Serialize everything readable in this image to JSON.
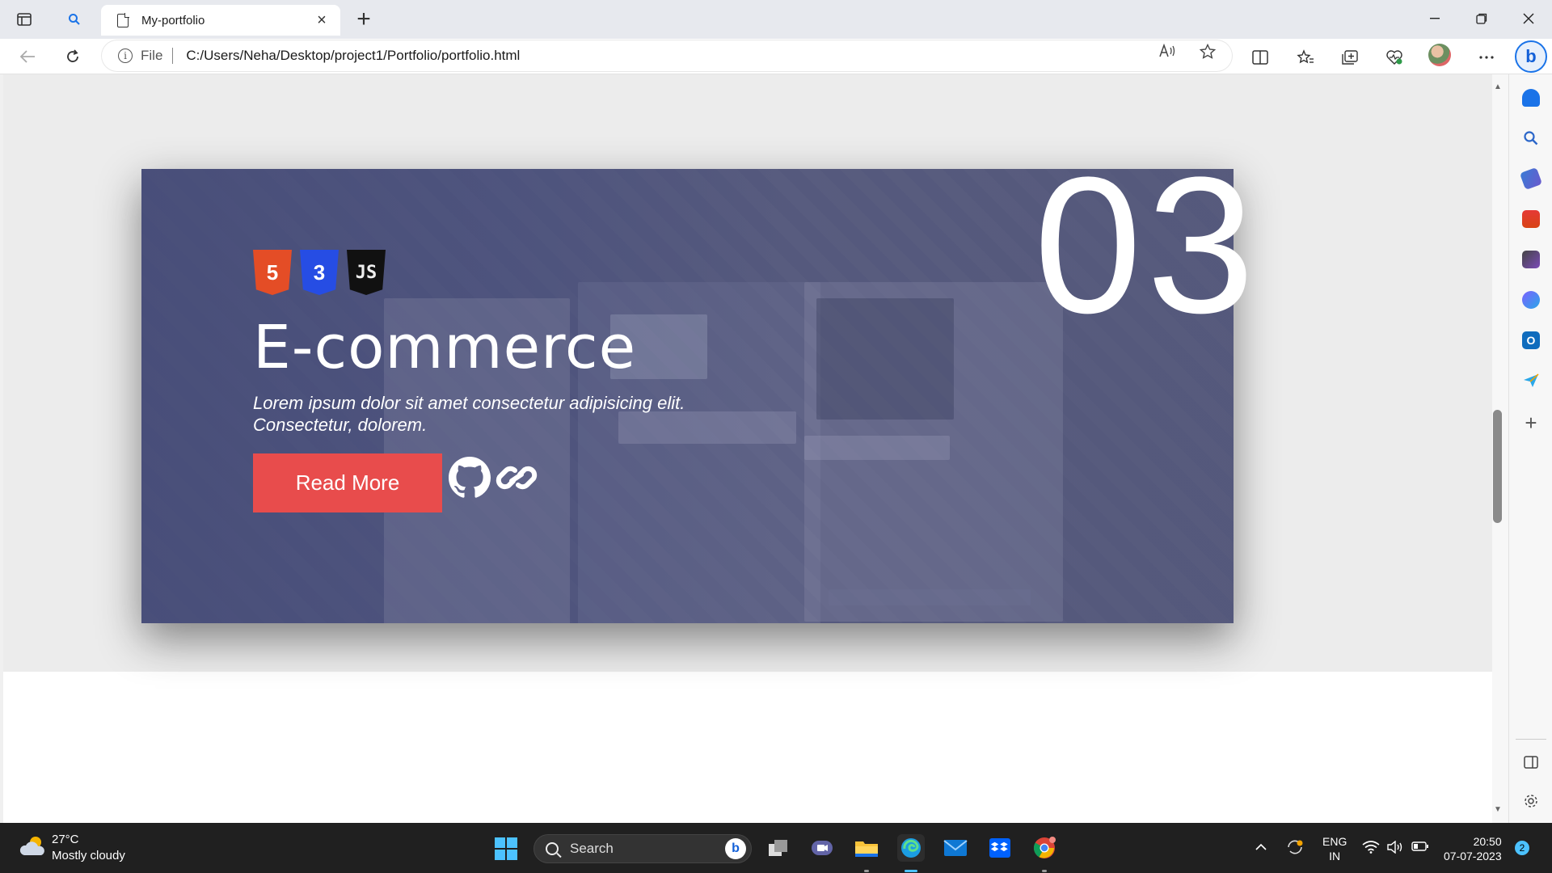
{
  "browser": {
    "tab_title": "My-portfolio",
    "address_scheme_label": "File",
    "address_url": "C:/Users/Neha/Desktop/project1/Portfolio/portfolio.html"
  },
  "project_card": {
    "number": "03",
    "tech_stack": [
      "HTML5",
      "CSS3",
      "JS"
    ],
    "tech_glyphs": [
      "5",
      "3",
      "JS"
    ],
    "title": "E-commerce",
    "description": "Lorem ipsum dolor sit amet consectetur adipisicing elit. Consectetur, dolorem.",
    "read_more_label": "Read More",
    "accent_color": "#e84c4c"
  },
  "taskbar": {
    "weather_temp": "27°C",
    "weather_desc": "Mostly cloudy",
    "search_label": "Search",
    "language_line1": "ENG",
    "language_line2": "IN",
    "time": "20:50",
    "date": "07-07-2023",
    "notification_count": "2"
  }
}
